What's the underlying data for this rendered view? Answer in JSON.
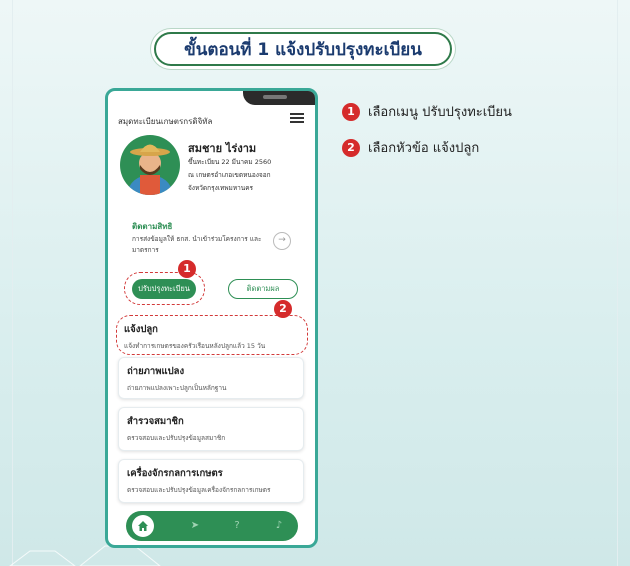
{
  "header": {
    "title": "ขั้นตอนที่ 1 แจ้งปรับปรุงทะเบียน"
  },
  "app": {
    "title": "สมุดทะเบียนเกษตรกรดิจิทัล",
    "user": {
      "name": "สมชาย ไร่งาม",
      "line1": "ขึ้นทะเบียน 22 มีนาคม 2560",
      "line2": "ณ เกษตรอำเภอเขตหนองจอก",
      "line3": "จังหวัดกรุงเทพมหานคร"
    },
    "tracking": {
      "label": "ติดตามสิทธิ",
      "desc": "การส่งข้อมูลให้ ธกส. นำเข้าร่วมโครงการ และมาตรการ",
      "arrow": "→"
    },
    "buttons": {
      "update": "ปรับปรุงทะเบียน",
      "track": "ติดตามผล"
    },
    "cards": [
      {
        "title": "แจ้งปลูก",
        "desc": "แจ้งทำการเกษตรของครัวเรือนหลังปลูกแล้ว 15 วัน"
      },
      {
        "title": "ถ่ายภาพแปลง",
        "desc": "ถ่ายภาพแปลงเพาะปลูกเป็นหลักฐาน"
      },
      {
        "title": "สำรวจสมาชิก",
        "desc": "ตรวจสอบและปรับปรุงข้อมูลสมาชิก"
      },
      {
        "title": "เครื่องจักรกลการเกษตร",
        "desc": "ตรวจสอบและปรับปรุงข้อมูลเครื่องจักรกลการเกษตร"
      }
    ],
    "nav": {
      "send": "➤",
      "help": "?",
      "bell": "♪"
    }
  },
  "callouts": {
    "one": "1",
    "two": "2"
  },
  "steps": [
    {
      "num": "1",
      "text": "เลือกเมนู ปรับปรุงทะเบียน"
    },
    {
      "num": "2",
      "text": "เลือกหัวข้อ แจ้งปลูก"
    }
  ],
  "colors": {
    "accent": "#2e8f55",
    "callout": "#d52b2b",
    "title_text": "#1b3b6f"
  }
}
